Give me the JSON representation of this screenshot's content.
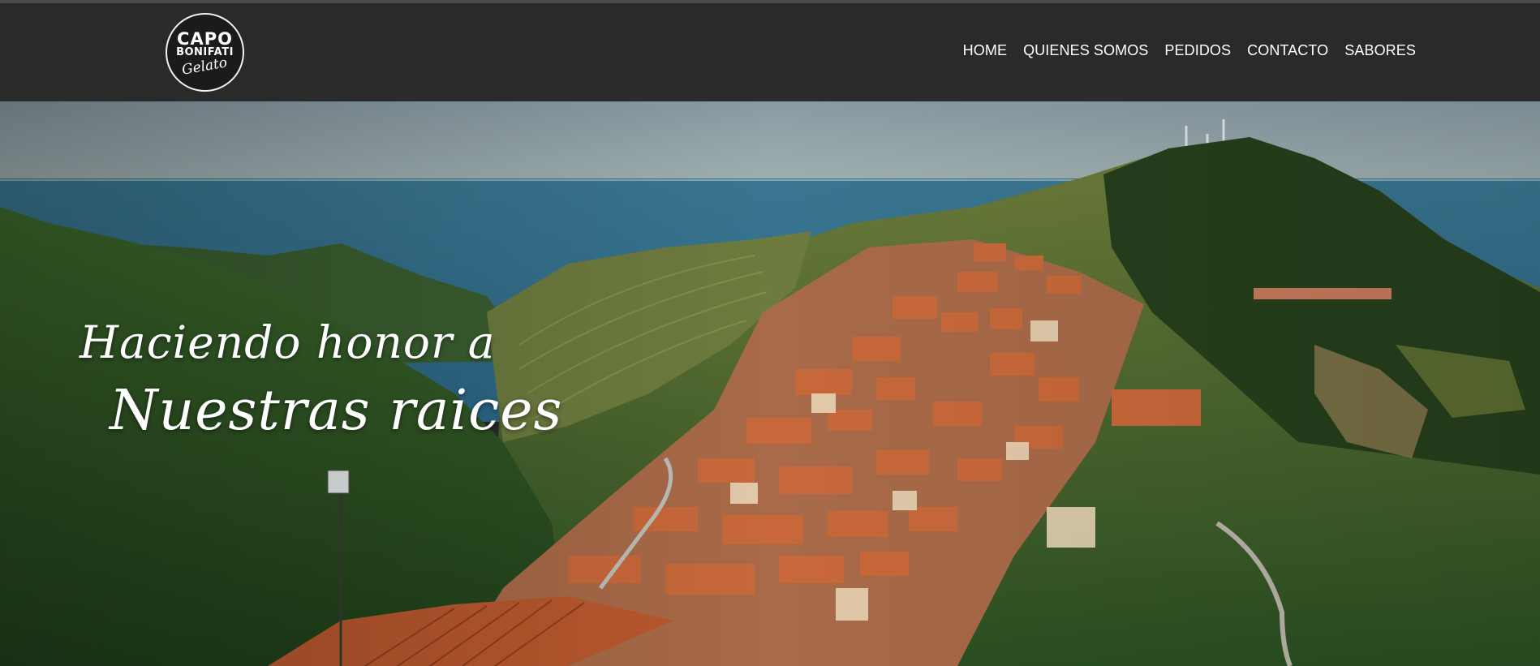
{
  "logo": {
    "line1": "CAPO",
    "line2": "BONIFATI",
    "line3": "Gelato"
  },
  "nav": [
    {
      "label": "HOME"
    },
    {
      "label": "QUIENES SOMOS"
    },
    {
      "label": "PEDIDOS"
    },
    {
      "label": "CONTACTO"
    },
    {
      "label": "SABORES"
    }
  ],
  "hero": {
    "line1": "Haciendo honor a",
    "line2": "Nuestras raices"
  },
  "colors": {
    "header_bg": "#2a2a2a",
    "sky": "#8fa3a8",
    "sea": "#2f6f8e",
    "hills": "#2f5a26",
    "roofs": "#c96a3a"
  }
}
